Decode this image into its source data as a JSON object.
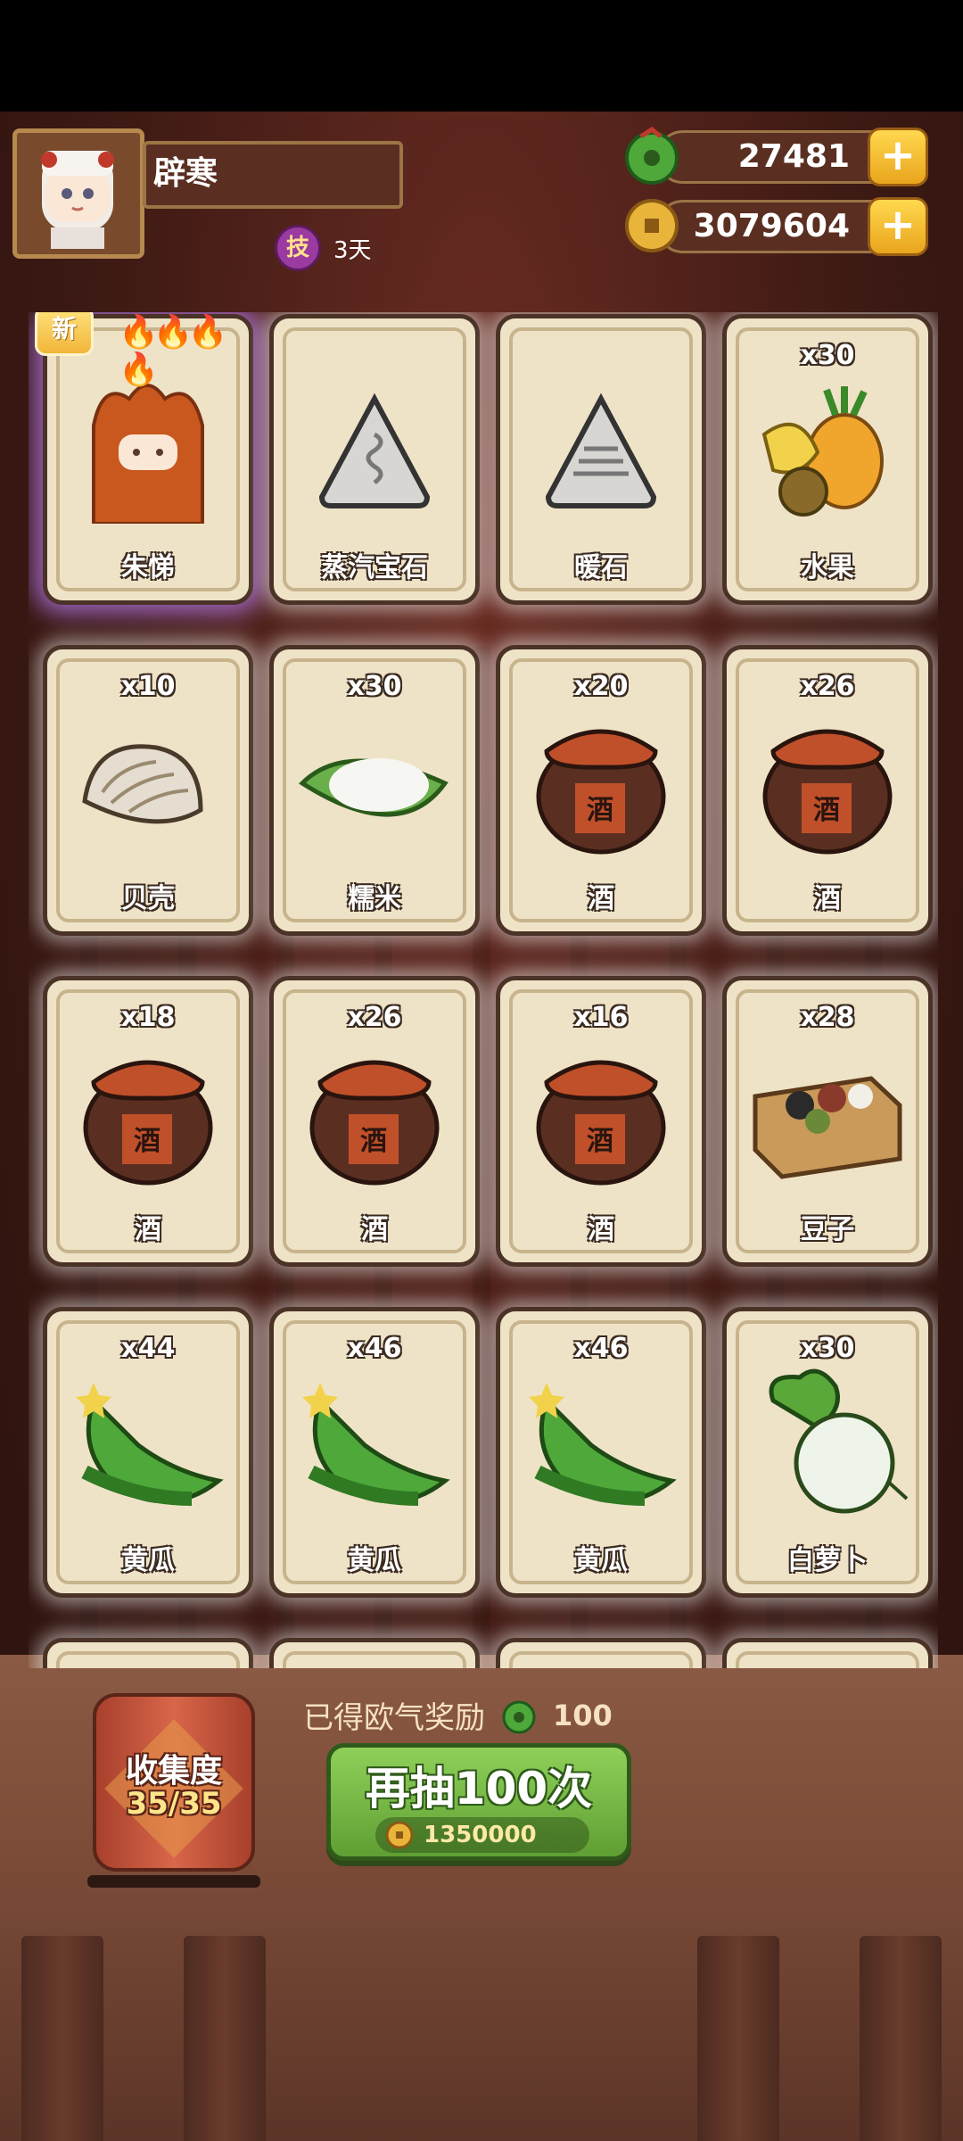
{
  "player": {
    "name": "辟寒",
    "skill_badge": "技",
    "skill_days": "3天"
  },
  "currencies": [
    {
      "name": "jade",
      "value": "27481",
      "plus": "+"
    },
    {
      "name": "coin",
      "value": "3079604",
      "plus": "+"
    }
  ],
  "new_badge": "新",
  "cards": [
    {
      "name": "朱悌",
      "count": "",
      "icon": "character-portrait",
      "is_new": true
    },
    {
      "name": "蒸汽宝石",
      "count": "",
      "icon": "steam-gem"
    },
    {
      "name": "暖石",
      "count": "",
      "icon": "warm-stone"
    },
    {
      "name": "水果",
      "count": "x30",
      "icon": "fruit"
    },
    {
      "name": "贝壳",
      "count": "x10",
      "icon": "shell"
    },
    {
      "name": "糯米",
      "count": "x30",
      "icon": "rice"
    },
    {
      "name": "酒",
      "count": "x20",
      "icon": "wine-jar"
    },
    {
      "name": "酒",
      "count": "x26",
      "icon": "wine-jar"
    },
    {
      "name": "酒",
      "count": "x18",
      "icon": "wine-jar"
    },
    {
      "name": "酒",
      "count": "x26",
      "icon": "wine-jar"
    },
    {
      "name": "酒",
      "count": "x16",
      "icon": "wine-jar"
    },
    {
      "name": "豆子",
      "count": "x28",
      "icon": "beans"
    },
    {
      "name": "黄瓜",
      "count": "x44",
      "icon": "cucumber"
    },
    {
      "name": "黄瓜",
      "count": "x46",
      "icon": "cucumber"
    },
    {
      "name": "黄瓜",
      "count": "x46",
      "icon": "cucumber"
    },
    {
      "name": "白萝卜",
      "count": "x30",
      "icon": "white-radish"
    }
  ],
  "wine_char": "酒",
  "collection": {
    "title": "收集度",
    "progress": "35/35"
  },
  "reward": {
    "text": "已得欧气奖励",
    "value": "100"
  },
  "draw_button": {
    "label": "再抽100次",
    "cost": "1350000"
  }
}
